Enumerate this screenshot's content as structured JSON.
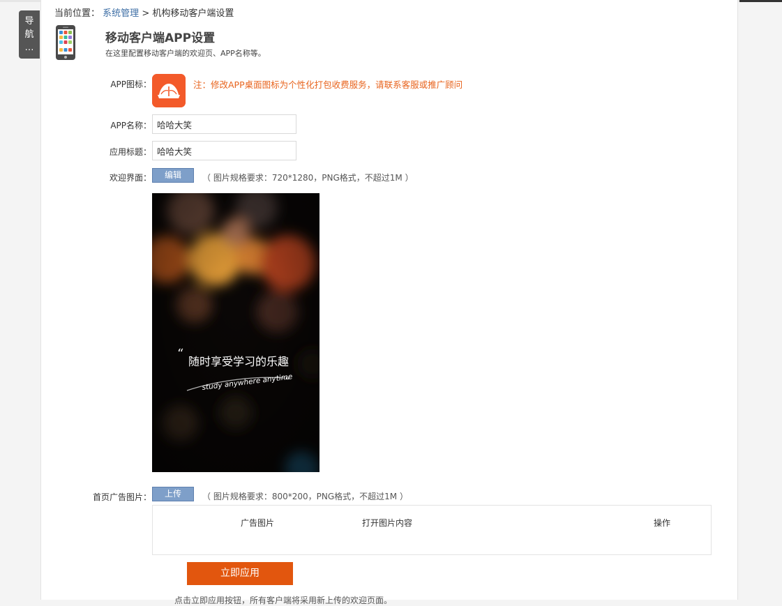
{
  "nav": {
    "char1": "导",
    "char2": "航",
    "more": "…"
  },
  "breadcrumb": {
    "prefix": "当前位置：",
    "parent": "系统管理",
    "separator": ">",
    "current": "机构移动客户端设置"
  },
  "header": {
    "title": "移动客户端APP设置",
    "subtitle": "在这里配置移动客户端的欢迎页、APP名称等。"
  },
  "form": {
    "app_icon_label": "APP图标：",
    "app_icon_note": "注：修改APP桌面图标为个性化打包收费服务，请联系客服或推广顾问",
    "app_name_label": "APP名称：",
    "app_name_value": "哈哈大笑",
    "app_title_label": "应用标题：",
    "app_title_value": "哈哈大笑",
    "welcome_label": "欢迎界面：",
    "welcome_button": "编辑",
    "welcome_hint": "（ 图片规格要求：720*1280，PNG格式，不超过1M ）",
    "welcome_image_text_cn": "随时享受学习的乐趣",
    "welcome_image_text_en": "study anywhere anytime",
    "ad_label": "首页广告图片：",
    "ad_button": "上传",
    "ad_hint": "（ 图片规格要求：800*200，PNG格式，不超过1M ）"
  },
  "ad_table": {
    "columns": [
      "广告图片",
      "打开图片内容",
      "操作"
    ]
  },
  "apply_button": "立即应用",
  "footnote": "点击立即应用按钮，所有客户端将采用新上传的欢迎页面。",
  "colors": {
    "accent_orange": "#e2560e",
    "note_orange": "#e8641e",
    "button_blue": "#7e9fc9",
    "link_blue": "#3d6ea5"
  }
}
